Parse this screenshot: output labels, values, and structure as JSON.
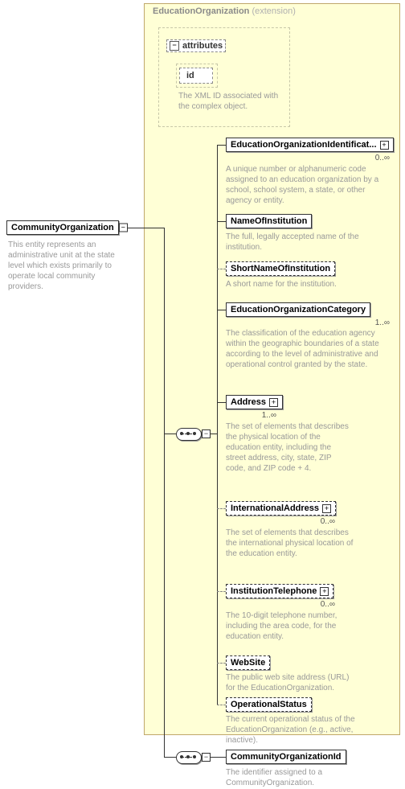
{
  "root": {
    "name": "CommunityOrganization",
    "desc": "This entity represents an administrative unit at the state level which exists primarily to operate local community providers."
  },
  "extension": {
    "label": "EducationOrganization",
    "suffix": "(extension)"
  },
  "attributes": {
    "label": "attributes",
    "id": {
      "name": "id",
      "desc": "The XML ID associated with the complex object."
    }
  },
  "elements": {
    "eoic": {
      "name": "EducationOrganizationIdentificat...",
      "occur": "0..∞",
      "desc": "A unique number or alphanumeric code assigned to an education organization by a school, school system, a state, or other agency or entity."
    },
    "noi": {
      "name": "NameOfInstitution",
      "desc": "The full, legally accepted name of the institution."
    },
    "snoi": {
      "name": "ShortNameOfInstitution",
      "desc": "A short name for the institution."
    },
    "eoc": {
      "name": "EducationOrganizationCategory",
      "occur": "1..∞",
      "desc": "The classification of the education agency within the geographic boundaries of a state according to the level of administrative and operational control granted by the state."
    },
    "addr": {
      "name": "Address",
      "occur": "1..∞",
      "desc": "The set of elements that describes the physical location of the education entity, including the street address, city, state, ZIP code, and ZIP code + 4."
    },
    "iaddr": {
      "name": "InternationalAddress",
      "occur": "0..∞",
      "desc": "The set of elements that describes the international physical location of the education entity."
    },
    "tel": {
      "name": "InstitutionTelephone",
      "occur": "0..∞",
      "desc": "The 10-digit telephone number, including the area code, for the education entity."
    },
    "web": {
      "name": "WebSite",
      "desc": "The public web site address (URL) for the EducationOrganization."
    },
    "op": {
      "name": "OperationalStatus",
      "desc": "The current operational status of the EducationOrganization (e.g., active, inactive)."
    }
  },
  "lower": {
    "coi": {
      "name": "CommunityOrganizationId",
      "desc": "The identifier assigned to a CommunityOrganization."
    }
  }
}
